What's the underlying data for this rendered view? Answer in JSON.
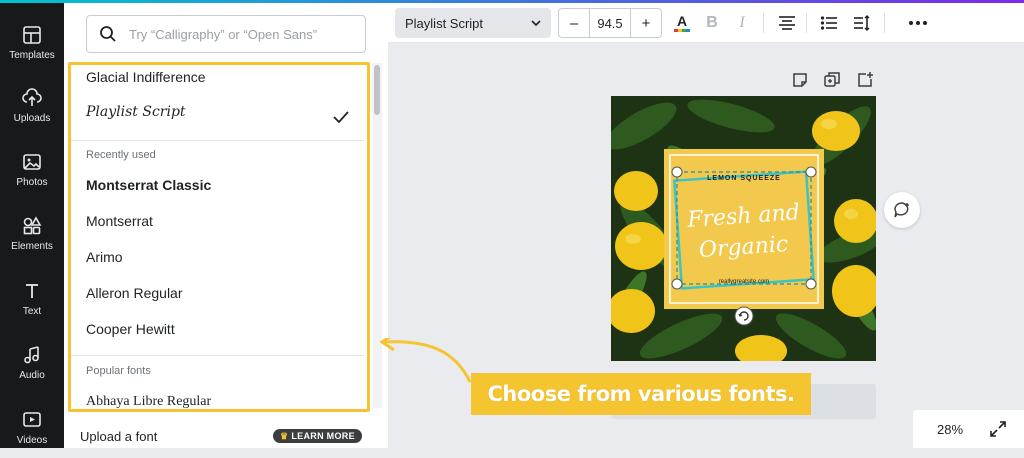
{
  "sidebar": {
    "items": [
      {
        "label": "Templates",
        "icon": "templates-icon"
      },
      {
        "label": "Uploads",
        "icon": "uploads-icon"
      },
      {
        "label": "Photos",
        "icon": "photos-icon"
      },
      {
        "label": "Elements",
        "icon": "elements-icon"
      },
      {
        "label": "Text",
        "icon": "text-icon"
      },
      {
        "label": "Audio",
        "icon": "audio-icon"
      },
      {
        "label": "Videos",
        "icon": "videos-icon"
      }
    ]
  },
  "font_panel": {
    "search_placeholder": "Try “Calligraphy” or “Open Sans”",
    "current_fonts": [
      "Glacial Indifference",
      "Playlist Script"
    ],
    "selected_font": "Playlist Script",
    "recently_used_label": "Recently used",
    "recently_used": [
      "Montserrat Classic",
      "Montserrat",
      "Arimo",
      "Alleron Regular",
      "Cooper Hewitt"
    ],
    "popular_label": "Popular fonts",
    "popular": [
      "Abhaya Libre Regular"
    ],
    "upload_font_label": "Upload a font",
    "learn_more_label": "LEARN MORE"
  },
  "toolbar": {
    "font_name": "Playlist Script",
    "font_size": "94.5",
    "minus": "–",
    "plus": "+",
    "text_color_accent": "#1f2225",
    "icons": [
      "text-color-icon",
      "bold-icon",
      "italic-icon",
      "align-center-icon",
      "list-icon",
      "line-spacing-icon",
      "more-icon"
    ]
  },
  "design": {
    "small_heading": "LEMON SQUEEZE",
    "headline_line1": "Fresh and",
    "headline_line2": "Organic",
    "website": "reallygreatsite.com",
    "card_color": "#f2c94c",
    "accent_color": "#3bc4c4"
  },
  "zoom": {
    "level": "28%"
  },
  "callout": {
    "text": "Choose from various fonts."
  },
  "colors": {
    "highlight": "#f5c431",
    "rail": "#18191b"
  }
}
